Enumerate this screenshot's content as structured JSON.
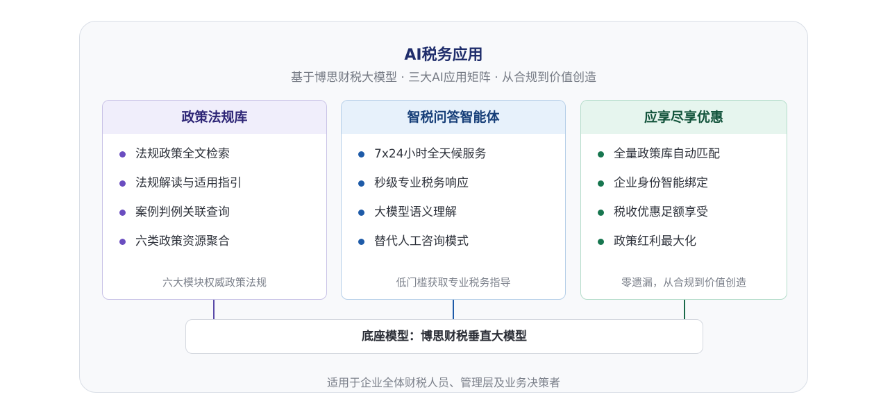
{
  "title": "AI税务应用",
  "subtitle": "基于博思财税大模型 · 三大AI应用矩阵 · 从合规到价值创造",
  "colors": {
    "card1_accent": "#6a4dc0",
    "card2_accent": "#1e5ba8",
    "card3_accent": "#17764f"
  },
  "cards": [
    {
      "title": "政策法规库",
      "items": [
        "法规政策全文检索",
        "法规解读与适用指引",
        "案例判例关联查询",
        "六类政策资源聚合"
      ],
      "footer": "六大模块权威政策法规"
    },
    {
      "title": "智税问答智能体",
      "items": [
        "7x24小时全天候服务",
        "秒级专业税务响应",
        "大模型语义理解",
        "替代人工咨询模式"
      ],
      "footer": "低门槛获取专业税务指导"
    },
    {
      "title": "应享尽享优惠",
      "items": [
        "全量政策库自动匹配",
        "企业身份智能绑定",
        "税收优惠足额享受",
        "政策红利最大化"
      ],
      "footer": "零遗漏，从合规到价值创造"
    }
  ],
  "base": "底座模型：博思财税垂直大模型",
  "footer": "适用于企业全体财税人员、管理层及业务决策者"
}
